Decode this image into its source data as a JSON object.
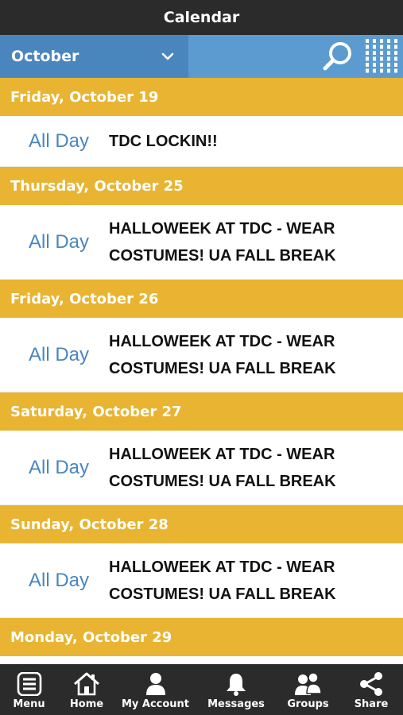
{
  "title": "Calendar",
  "toolbar": {
    "month": "October",
    "icons": {
      "dropdown": "chevron-down-icon",
      "search": "search-icon",
      "view": "grid-icon"
    }
  },
  "colors": {
    "title_bar": "#2b2b2b",
    "toolbar": "#5b9bd0",
    "month_select": "#4a86be",
    "day_header": "#e8b431",
    "all_day_text": "#4a86be"
  },
  "days": [
    {
      "date": "Friday, October 19",
      "events": [
        {
          "time": "All Day",
          "line1": "TDC LOCKIN!!",
          "line2": ""
        }
      ]
    },
    {
      "date": "Thursday, October 25",
      "events": [
        {
          "time": "All Day",
          "line1": "HALLOWEEK AT TDC - WEAR",
          "line2": "COSTUMES! UA FALL BREAK"
        }
      ]
    },
    {
      "date": "Friday, October 26",
      "events": [
        {
          "time": "All Day",
          "line1": "HALLOWEEK AT TDC - WEAR",
          "line2": "COSTUMES! UA FALL BREAK"
        }
      ]
    },
    {
      "date": "Saturday, October 27",
      "events": [
        {
          "time": "All Day",
          "line1": "HALLOWEEK AT TDC - WEAR",
          "line2": "COSTUMES! UA FALL BREAK"
        }
      ]
    },
    {
      "date": "Sunday, October 28",
      "events": [
        {
          "time": "All Day",
          "line1": "HALLOWEEK AT TDC - WEAR",
          "line2": "COSTUMES! UA FALL BREAK"
        }
      ]
    },
    {
      "date": "Monday, October 29",
      "events": []
    }
  ],
  "tabbar": {
    "items": [
      {
        "label": "Menu",
        "icon": "menu-icon"
      },
      {
        "label": "Home",
        "icon": "home-icon"
      },
      {
        "label": "My Account",
        "icon": "account-icon"
      },
      {
        "label": "Messages",
        "icon": "bell-icon"
      },
      {
        "label": "Groups",
        "icon": "groups-icon"
      },
      {
        "label": "Share",
        "icon": "share-icon"
      }
    ]
  }
}
